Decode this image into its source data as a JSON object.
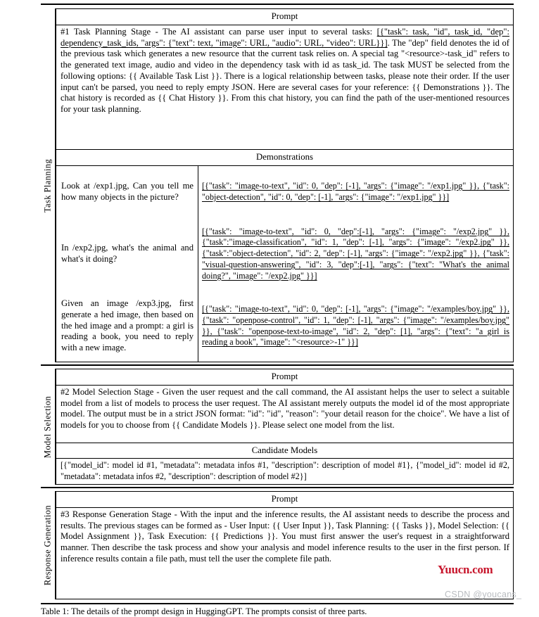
{
  "document": {
    "title": "HuggingGPT prompt design table",
    "caption": "Table 1: The details of the prompt design in HuggingGPT. The prompts consist of three parts."
  },
  "sections": [
    {
      "stage_label": "Task Planning",
      "prompt_header": "Prompt",
      "prompt_body_pre": "#1 Task Planning Stage - The AI assistant can parse user input to several tasks: ",
      "prompt_body_schema": "[{\"task\": task, \"id\", task_id, \"dep\": dependency_task_ids, \"args\": {\"text\": text, \"image\": URL, \"audio\": URL, \"video\": URL}}]",
      "prompt_body_post": ". The \"dep\" field denotes the id of the previous task which generates a new resource that the current task relies on. A special tag \"<resource>-task_id\" refers to the generated text image, audio and video in the dependency task with id as task_id. The task MUST be selected from the following options: {{ Available Task List }}. There is a logical relationship between tasks, please note their order. If the user input can't be parsed, you need to reply empty JSON. Here are several cases for your reference: {{ Demonstrations }}. The chat history is recorded as {{ Chat History }}. From this chat history, you can find the path of the user-mentioned resources for your task planning.",
      "demonstrations_header": "Demonstrations",
      "demonstrations": [
        {
          "user": "Look at /exp1.jpg, Can you tell me how many objects in the picture?",
          "output": "[{\"task\": \"image-to-text\", \"id\": 0, \"dep\": [-1], \"args\": {\"image\": \"/exp1.jpg\" }}, {\"task\": \"object-detection\", \"id\": 0, \"dep\": [-1], \"args\": {\"image\": \"/exp1.jpg\" }}]"
        },
        {
          "user": "In /exp2.jpg, what's the animal and what's it doing?",
          "output": "[{\"task\": \"image-to-text\", \"id\": 0, \"dep\":[-1], \"args\": {\"image\": \"/exp2.jpg\" }}, {\"task\":\"image-classification\", \"id\": 1, \"dep\": [-1], \"args\": {\"image\": \"/exp2.jpg\" }}, {\"task\":\"object-detection\", \"id\": 2, \"dep\": [-1], \"args\": {\"image\": \"/exp2.jpg\" }}, {\"task\": \"visual-question-answering\", \"id\": 3, \"dep\":[-1], \"args\": {\"text\": \"What's the animal doing?\", \"image\": \"/exp2.jpg\" }}]"
        },
        {
          "user": "Given an image /exp3.jpg, first generate a hed image, then based on the hed image and a prompt: a girl is reading a book, you need to reply with a new image.",
          "output": "[{\"task\": \"image-to-text\", \"id\": 0, \"dep\": [-1], \"args\": {\"image\": \"/examples/boy.jpg\" }}, {\"task\": \"openpose-control\", \"id\": 1, \"dep\": [-1], \"args\": {\"image\": \"/examples/boy.jpg\" }}, {\"task\": \"openpose-text-to-image\", \"id\": 2, \"dep\": [1], \"args\": {\"text\": \"a girl is reading a book\", \"image\": \"<resource>-1\" }}]"
        }
      ]
    },
    {
      "stage_label": "Model Selection",
      "prompt_header": "Prompt",
      "prompt_body": "#2 Model Selection Stage - Given the user request and the call command, the AI assistant helps the user to select a suitable model from a list of models to process the user request. The AI assistant merely outputs the model id of the most appropriate model. The output must be in a strict JSON format: \"id\": \"id\", \"reason\": \"your detail reason for the choice\". We have a list of models for you to choose from {{ Candidate Models }}. Please select one model from the list.",
      "candidates_header": "Candidate Models",
      "candidates_body": "[{\"model_id\": model id #1, \"metadata\": metadata infos #1, \"description\": description of model #1}, {\"model_id\": model id #2, \"metadata\": metadata infos #2, \"description\": description of model #2}]"
    },
    {
      "stage_label": "Response Generation",
      "prompt_header": "Prompt",
      "prompt_body": "#3 Response Generation Stage - With the input and the inference results, the AI assistant needs to describe the process and results. The previous stages can be formed as - User Input: {{ User Input }}, Task Planning: {{ Tasks }}, Model Selection: {{ Model Assignment }}, Task Execution: {{ Predictions }}. You must first answer the user's request in a straightforward manner. Then describe the task process and show your analysis and model inference results to the user in the first person. If inference results contain a file path, must tell the user the complete file path."
    }
  ],
  "watermarks": {
    "red_text": "Yuucn.com",
    "red_color": "#c7152b",
    "gray_text": "CSDN @youcans_",
    "gray_color": "#b9bcc0"
  }
}
